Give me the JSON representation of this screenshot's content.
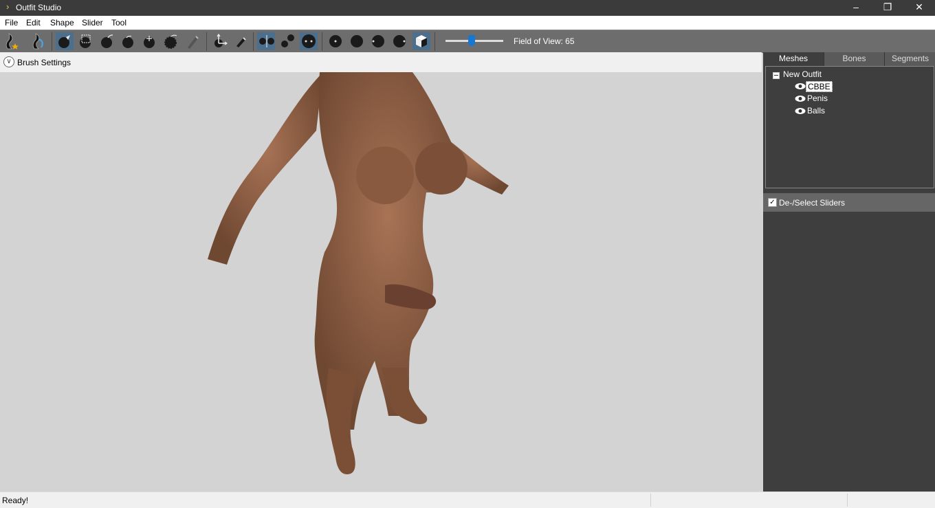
{
  "window": {
    "title": "Outfit Studio"
  },
  "menu": [
    "File",
    "Edit",
    "Shape",
    "Slider",
    "Tool"
  ],
  "toolbar": {
    "tools": [
      {
        "name": "load-reference-icon",
        "active": false
      },
      {
        "name": "load-outfit-icon",
        "active": false
      },
      {
        "name": "select-brush-icon",
        "active": true
      },
      {
        "name": "mask-brush-icon",
        "active": false
      },
      {
        "name": "inflate-brush-icon",
        "active": false
      },
      {
        "name": "deflate-brush-icon",
        "active": false
      },
      {
        "name": "move-brush-icon",
        "active": false
      },
      {
        "name": "smooth-brush-icon",
        "active": false
      },
      {
        "name": "weight-brush-icon",
        "active": false
      },
      {
        "name": "transform-icon",
        "active": false
      },
      {
        "name": "pivot-icon",
        "active": false
      },
      {
        "name": "mirror-x-icon",
        "active": true
      },
      {
        "name": "mirror-y-icon",
        "active": false
      },
      {
        "name": "mirror-z-icon",
        "active": true
      },
      {
        "name": "view-front-icon",
        "active": false
      },
      {
        "name": "view-back-icon",
        "active": false
      },
      {
        "name": "view-left-icon",
        "active": false
      },
      {
        "name": "view-right-icon",
        "active": false
      },
      {
        "name": "perspective-icon",
        "active": true
      }
    ],
    "fov_label": "Field of View: 65",
    "fov_value": 65
  },
  "brush_settings": {
    "label": "Brush Settings"
  },
  "panel": {
    "tabs": [
      "Meshes",
      "Bones",
      "Segments"
    ],
    "active_tab": "Meshes",
    "tree": {
      "root": "New Outfit",
      "items": [
        "CBBE",
        "Penis",
        "Balls"
      ],
      "selected": "CBBE"
    },
    "sliders_header": "De-/Select Sliders",
    "sliders_checked": true
  },
  "status": {
    "text": "Ready!"
  }
}
